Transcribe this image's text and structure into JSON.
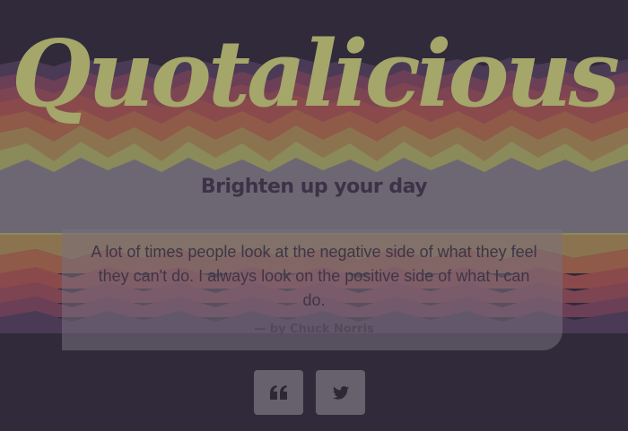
{
  "brand": {
    "logo_text": "Quotalicious",
    "tagline": "Brighten up your day"
  },
  "quote": {
    "text": "A lot of times people look at the negative side of what they feel they can't do. I always look on the positive side of what I can do.",
    "author": "— by Chuck Norris"
  },
  "actions": {
    "new_quote_icon": "quote-left-icon",
    "tweet_icon": "twitter-icon"
  },
  "colors": {
    "background": "#302a3a",
    "logo": "#a4a66a",
    "card": "#78707e",
    "button": "#67606d",
    "wave_bands": [
      "#4a3a55",
      "#6b3f55",
      "#7d4452",
      "#8a4a4c",
      "#8f5a48",
      "#8c7350",
      "#8b8a5a"
    ]
  }
}
